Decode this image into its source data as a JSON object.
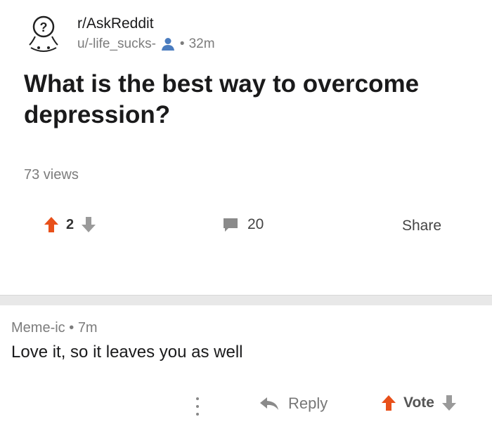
{
  "post": {
    "subreddit": "r/AskReddit",
    "author": "u/-life_sucks-",
    "age": "32m",
    "meta_separator": "•",
    "title": "What is the best way to overcome depression?",
    "views": "73 views",
    "score": "2",
    "comment_count": "20",
    "share_label": "Share"
  },
  "comment": {
    "author": "Meme-ic",
    "meta_separator": "•",
    "age": "7m",
    "body": "Love it, so it leaves you as well",
    "reply_label": "Reply",
    "vote_label": "Vote"
  },
  "icons": {
    "avatar": "question-mark-avatar-icon",
    "person": "person-icon",
    "upvote": "upvote-arrow-icon",
    "downvote": "downvote-arrow-icon",
    "comment": "comment-bubble-icon",
    "more": "more-vertical-icon",
    "reply": "reply-arrow-icon"
  },
  "colors": {
    "upvote_active": "#e8501a",
    "downvote": "#9a9a9a",
    "person_icon": "#4a7cbf",
    "meta_text": "#7c7c7c",
    "divider": "#e8e8e8"
  }
}
